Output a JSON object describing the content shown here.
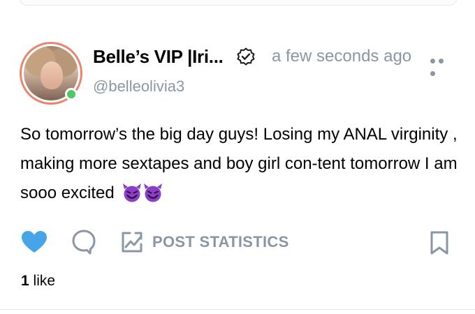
{
  "post": {
    "author_name": "Belle’s VIP |Iri...",
    "handle": "@belleolivia3",
    "timestamp": "a few seconds ago",
    "text": "So tomorrow’s the big day guys! Losing my ANAL virginity , making more sextapes and boy girl con-tent tomorrow I am sooo excited",
    "emojis": [
      "smiling-face-with-horns",
      "smiling-face-with-horns"
    ],
    "online": true,
    "liked": true
  },
  "actions": {
    "stats_label": "POST STATISTICS",
    "likes_count": "1",
    "likes_label": "like"
  },
  "colors": {
    "accent": "#46a5e8",
    "muted": "#8a96a3",
    "online": "#4cc864",
    "avatar_ring": "#e8866d",
    "emoji": "#8c3ec4"
  },
  "icons": [
    "verified-icon",
    "more-icon",
    "heart-icon",
    "comment-icon",
    "chart-icon",
    "bookmark-icon"
  ]
}
